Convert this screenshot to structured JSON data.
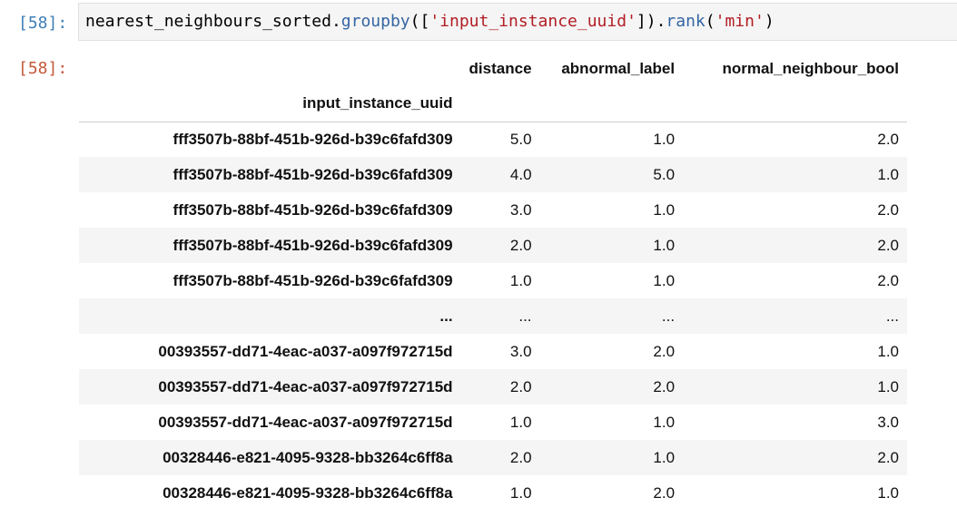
{
  "cell": {
    "input_prompt": "[58]:",
    "output_prompt": "[58]:",
    "code_tokens": [
      {
        "text": "nearest_neighbours_sorted",
        "kind": "name"
      },
      {
        "text": ".",
        "kind": "dot"
      },
      {
        "text": "groupby",
        "kind": "method"
      },
      {
        "text": "([",
        "kind": "punct"
      },
      {
        "text": "'input_instance_uuid'",
        "kind": "str"
      },
      {
        "text": "]).",
        "kind": "punct"
      },
      {
        "text": "rank",
        "kind": "method"
      },
      {
        "text": "(",
        "kind": "punct"
      },
      {
        "text": "'min'",
        "kind": "str"
      },
      {
        "text": ")",
        "kind": "punct"
      }
    ]
  },
  "dataframe": {
    "columns": [
      "distance",
      "abnormal_label",
      "normal_neighbour_bool"
    ],
    "index_name": "input_instance_uuid",
    "rows": [
      {
        "index": "fff3507b-88bf-451b-926d-b39c6fafd309",
        "values": [
          "5.0",
          "1.0",
          "2.0"
        ]
      },
      {
        "index": "fff3507b-88bf-451b-926d-b39c6fafd309",
        "values": [
          "4.0",
          "5.0",
          "1.0"
        ]
      },
      {
        "index": "fff3507b-88bf-451b-926d-b39c6fafd309",
        "values": [
          "3.0",
          "1.0",
          "2.0"
        ]
      },
      {
        "index": "fff3507b-88bf-451b-926d-b39c6fafd309",
        "values": [
          "2.0",
          "1.0",
          "2.0"
        ]
      },
      {
        "index": "fff3507b-88bf-451b-926d-b39c6fafd309",
        "values": [
          "1.0",
          "1.0",
          "2.0"
        ]
      },
      {
        "index": "...",
        "values": [
          "...",
          "...",
          "..."
        ]
      },
      {
        "index": "00393557-dd71-4eac-a037-a097f972715d",
        "values": [
          "3.0",
          "2.0",
          "1.0"
        ]
      },
      {
        "index": "00393557-dd71-4eac-a037-a097f972715d",
        "values": [
          "2.0",
          "2.0",
          "1.0"
        ]
      },
      {
        "index": "00393557-dd71-4eac-a037-a097f972715d",
        "values": [
          "1.0",
          "1.0",
          "3.0"
        ]
      },
      {
        "index": "00328446-e821-4095-9328-bb3264c6ff8a",
        "values": [
          "2.0",
          "1.0",
          "2.0"
        ]
      },
      {
        "index": "00328446-e821-4095-9328-bb3264c6ff8a",
        "values": [
          "1.0",
          "2.0",
          "1.0"
        ]
      }
    ]
  }
}
